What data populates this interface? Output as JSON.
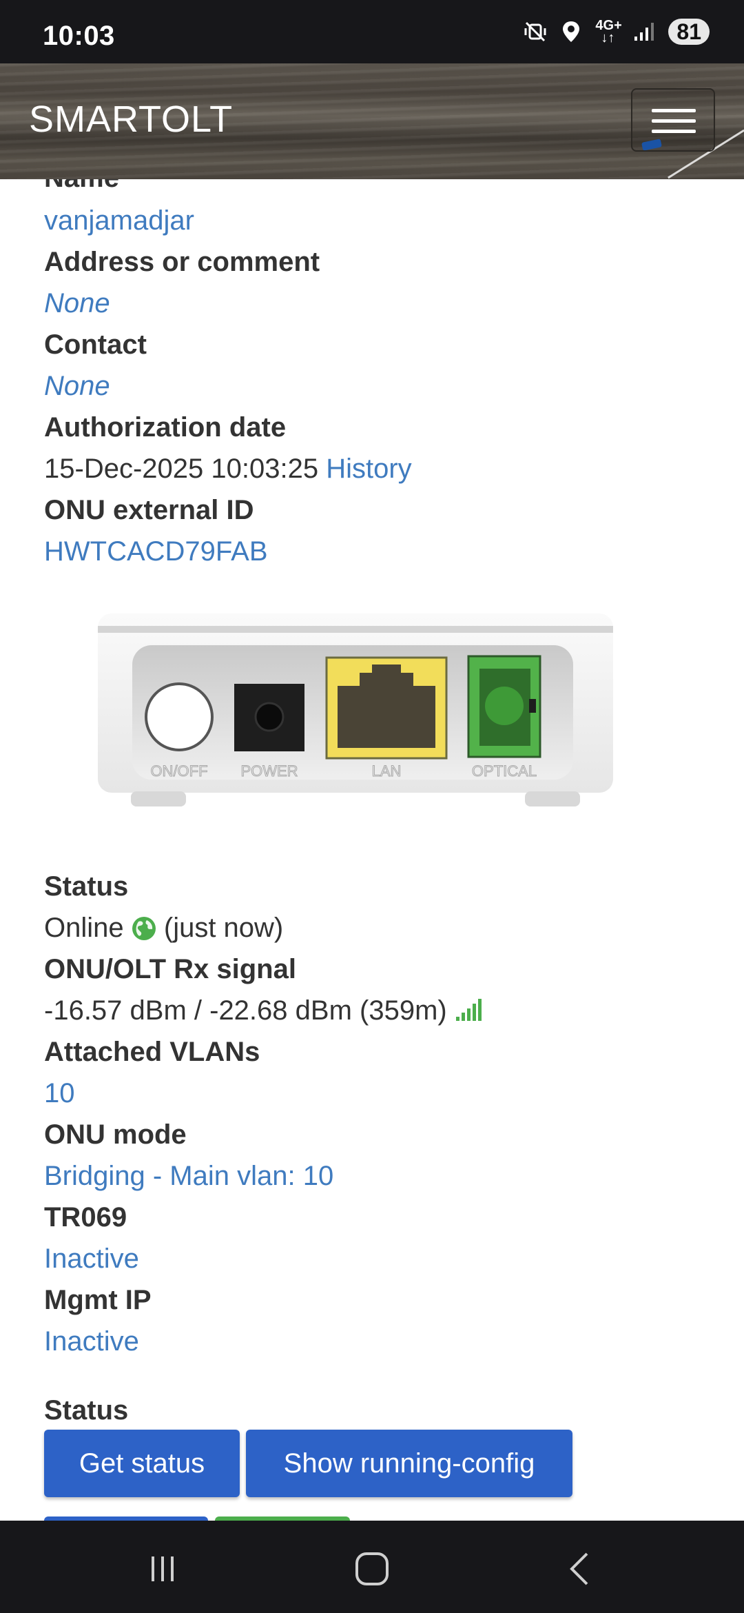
{
  "status_bar": {
    "time": "10:03",
    "network": "4G+",
    "battery": "81",
    "icons": [
      "mute-vibrate-icon",
      "location-icon",
      "network-4g-icon",
      "signal-icon"
    ]
  },
  "navbar": {
    "brand": "SMARTOLT",
    "menu_icon": "hamburger-icon"
  },
  "fields": {
    "name_label": "Name",
    "name_value": "vanjamadjar",
    "address_label": "Address or comment",
    "address_value": "None",
    "contact_label": "Contact",
    "contact_value": "None",
    "auth_date_label": "Authorization date",
    "auth_date_value": "15-Dec-2025 10:03:25",
    "auth_history_link": "History",
    "ext_id_label": "ONU external ID",
    "ext_id_value": "HWTCACD79FAB"
  },
  "device": {
    "ports": [
      "ON/OFF",
      "POWER",
      "LAN",
      "OPTICAL"
    ]
  },
  "status_fields": {
    "status_label": "Status",
    "status_value": "Online",
    "status_time": "(just now)",
    "signal_label": "ONU/OLT Rx signal",
    "signal_value": "-16.57 dBm / -22.68 dBm (359m)",
    "vlans_label": "Attached VLANs",
    "vlans_value": "10",
    "mode_label": "ONU mode",
    "mode_value": "Bridging - Main vlan: 10",
    "tr069_label": "TR069",
    "tr069_value": "Inactive",
    "mgmt_label": "Mgmt IP",
    "mgmt_value": "Inactive"
  },
  "actions": {
    "section_label": "Status",
    "get_status": "Get status",
    "show_config": "Show running-config"
  },
  "colors": {
    "link": "#3f7bbf",
    "primary_button": "#2d62c7",
    "success": "#4cae4c"
  }
}
